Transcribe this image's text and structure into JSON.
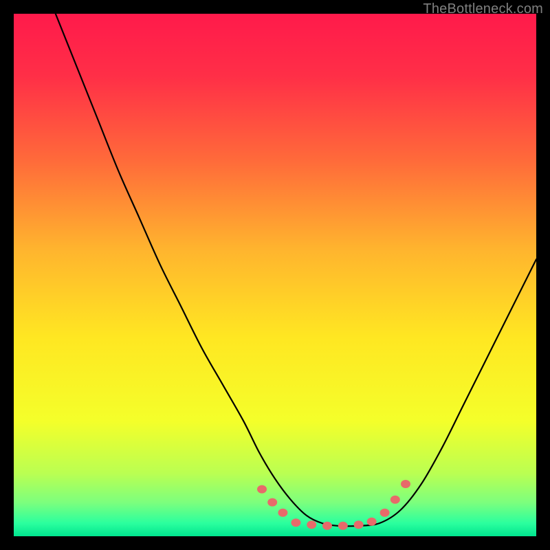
{
  "watermark": "TheBottleneck.com",
  "chart_data": {
    "type": "line",
    "title": "",
    "xlabel": "",
    "ylabel": "",
    "xlim": [
      0,
      100
    ],
    "ylim": [
      0,
      100
    ],
    "gradient_stops": [
      {
        "offset": 0.0,
        "color": "#ff1a4b"
      },
      {
        "offset": 0.12,
        "color": "#ff2f47"
      },
      {
        "offset": 0.28,
        "color": "#ff6a3a"
      },
      {
        "offset": 0.45,
        "color": "#ffb42e"
      },
      {
        "offset": 0.62,
        "color": "#ffe722"
      },
      {
        "offset": 0.78,
        "color": "#f4ff2a"
      },
      {
        "offset": 0.88,
        "color": "#baff52"
      },
      {
        "offset": 0.935,
        "color": "#7dff7d"
      },
      {
        "offset": 0.975,
        "color": "#2bff9e"
      },
      {
        "offset": 1.0,
        "color": "#00e58f"
      }
    ],
    "series": [
      {
        "name": "bottleneck-curve",
        "x": [
          8,
          12,
          16,
          20,
          24,
          28,
          32,
          36,
          40,
          44,
          47,
          50,
          53,
          56,
          59,
          62,
          66,
          70,
          74,
          78,
          82,
          86,
          90,
          94,
          98,
          100
        ],
        "y": [
          100,
          90,
          80,
          70,
          61,
          52,
          44,
          36,
          29,
          22,
          16,
          11,
          7,
          4,
          2.5,
          2,
          2,
          2.5,
          5,
          10,
          17,
          25,
          33,
          41,
          49,
          53
        ]
      }
    ],
    "marker_clusters": [
      {
        "name": "left-near-min",
        "points": [
          {
            "x": 47.5,
            "y": 9.0
          },
          {
            "x": 49.5,
            "y": 6.5
          },
          {
            "x": 51.5,
            "y": 4.5
          }
        ]
      },
      {
        "name": "valley-floor",
        "points": [
          {
            "x": 54,
            "y": 2.6
          },
          {
            "x": 57,
            "y": 2.2
          },
          {
            "x": 60,
            "y": 2.0
          },
          {
            "x": 63,
            "y": 2.0
          },
          {
            "x": 66,
            "y": 2.2
          },
          {
            "x": 68.5,
            "y": 2.8
          }
        ]
      },
      {
        "name": "right-rise",
        "points": [
          {
            "x": 71,
            "y": 4.5
          },
          {
            "x": 73,
            "y": 7.0
          },
          {
            "x": 75,
            "y": 10.0
          }
        ]
      }
    ],
    "marker_style": {
      "fill": "#e76a6a",
      "rx": 7,
      "ry": 6
    },
    "curve_style": {
      "stroke": "#000000",
      "width": 2.2
    }
  }
}
